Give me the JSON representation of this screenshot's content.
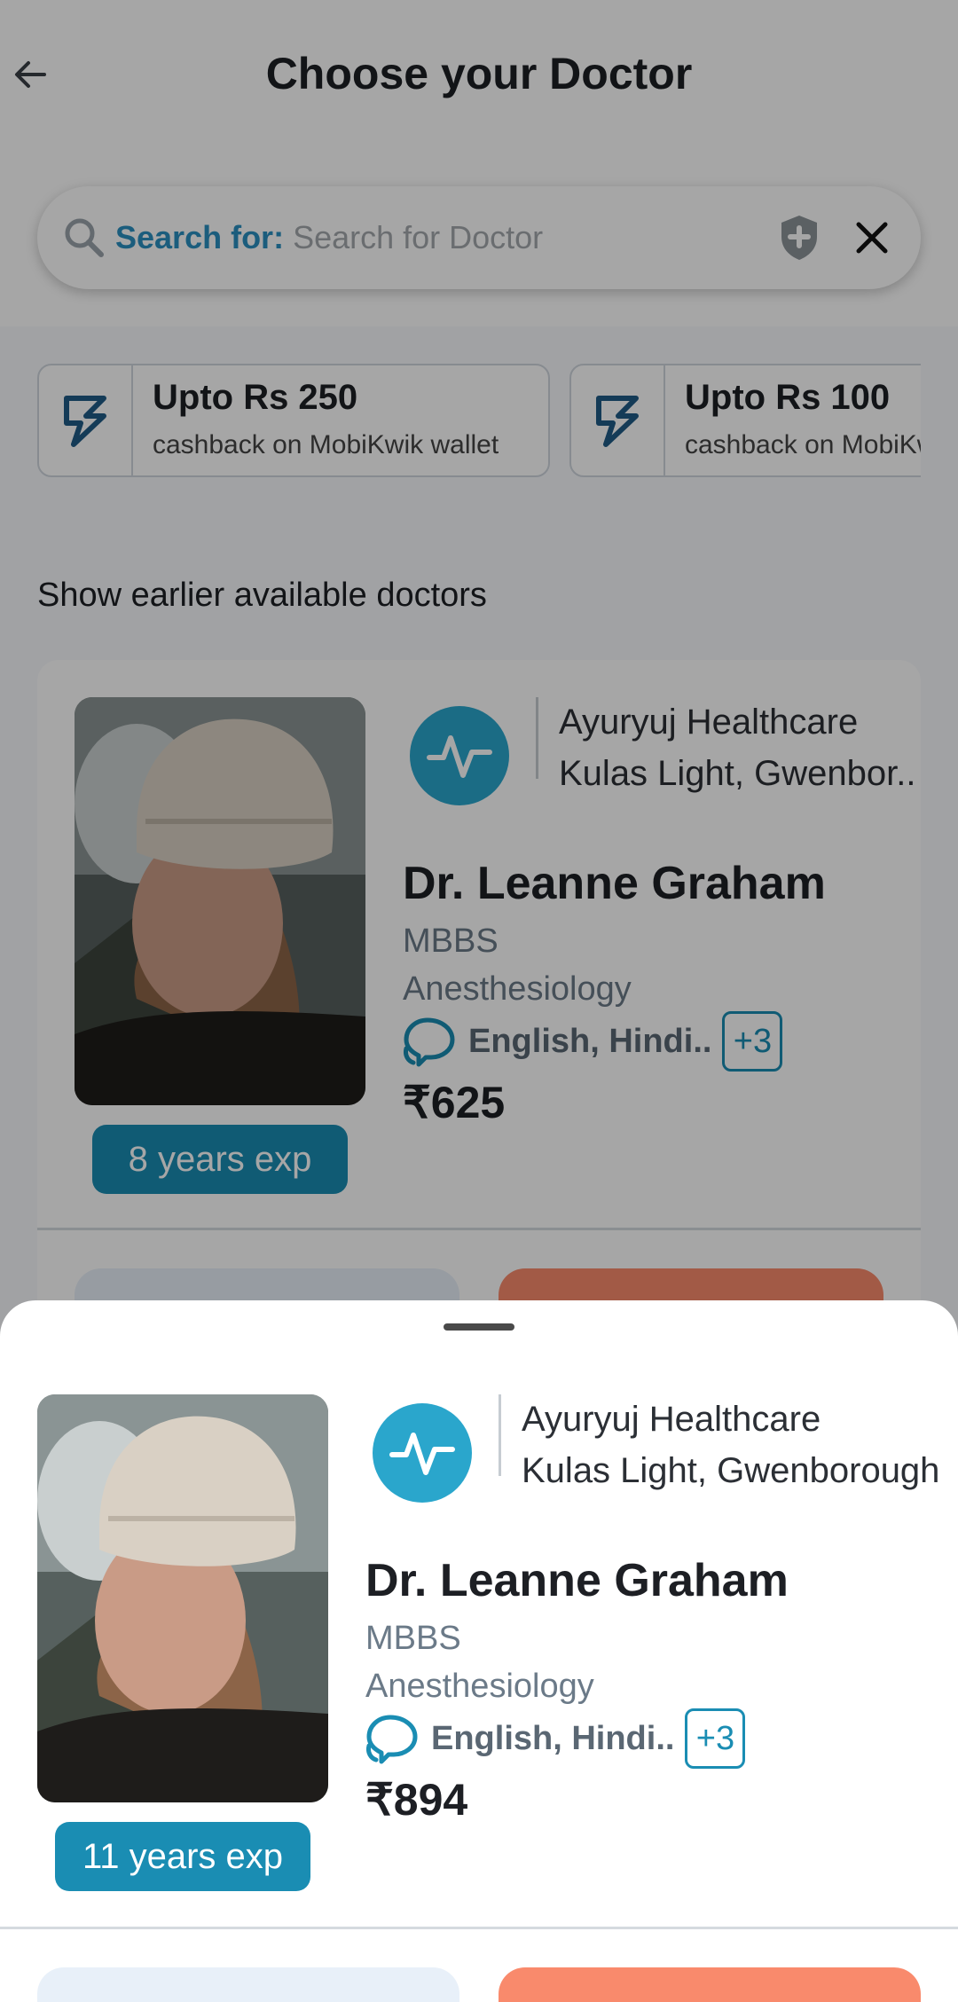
{
  "header": {
    "title": "Choose your Doctor",
    "search": {
      "prefix": "Search for:",
      "placeholder": "Search for Doctor",
      "value": ""
    }
  },
  "offers": [
    {
      "title": "Upto Rs 250",
      "subtitle": "cashback on MobiKwik wallet",
      "icon": "mobikwik-icon"
    },
    {
      "title": "Upto Rs 100",
      "subtitle": "cashback on MobiKwik wallet",
      "icon": "mobikwik-icon"
    }
  ],
  "section_title": "Show earlier available doctors",
  "doctor_card": {
    "clinic_name": "Ayuryuj Healthcare",
    "clinic_address": "Kulas Light, Gwenbor..",
    "name": "Dr. Leanne Graham",
    "degree": "MBBS",
    "specialty": "Anesthesiology",
    "languages": "English, Hindi..",
    "more_languages": "+3",
    "fee": "₹625",
    "experience": "8 years exp"
  },
  "sheet_doctor": {
    "clinic_name": "Ayuryuj Healthcare",
    "clinic_address": "Kulas Light, Gwenborough",
    "name": "Dr. Leanne Graham",
    "degree": "MBBS",
    "specialty": "Anesthesiology",
    "languages": "English, Hindi..",
    "more_languages": "+3",
    "fee": "₹894",
    "experience": "11 years exp"
  },
  "colors": {
    "accent": "#1a8db3",
    "clinic_logo": "#2aa6cc",
    "primary_button": "#f98a6c",
    "secondary_button": "#e8f0f9",
    "search_prefix": "#2a8fc0"
  }
}
